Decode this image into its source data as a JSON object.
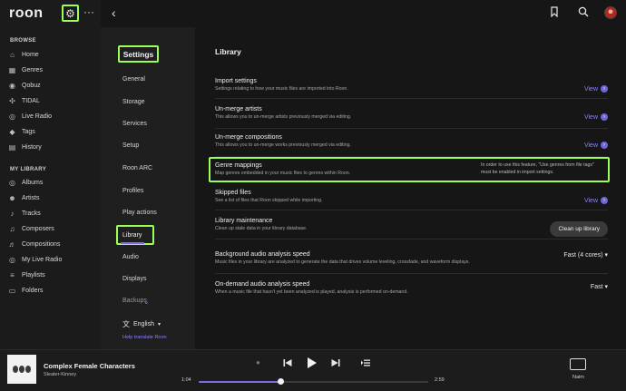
{
  "app": {
    "logo": "roon",
    "more": "···"
  },
  "sidebar": {
    "browse_header": "BROWSE",
    "browse_items": [
      {
        "label": "Home",
        "icon": "⌂"
      },
      {
        "label": "Genres",
        "icon": "▦"
      },
      {
        "label": "Qobuz",
        "icon": "◉"
      },
      {
        "label": "TIDAL",
        "icon": "✣"
      },
      {
        "label": "Live Radio",
        "icon": "◎"
      },
      {
        "label": "Tags",
        "icon": "◆"
      },
      {
        "label": "History",
        "icon": "▤"
      }
    ],
    "library_header": "MY LIBRARY",
    "library_items": [
      {
        "label": "Albums",
        "icon": "◎"
      },
      {
        "label": "Artists",
        "icon": "☻"
      },
      {
        "label": "Tracks",
        "icon": "♪"
      },
      {
        "label": "Composers",
        "icon": "♫"
      },
      {
        "label": "Compositions",
        "icon": "♬"
      },
      {
        "label": "My Live Radio",
        "icon": "◎"
      },
      {
        "label": "Playlists",
        "icon": "≡"
      },
      {
        "label": "Folders",
        "icon": "▭"
      }
    ]
  },
  "settings_nav": {
    "title": "Settings",
    "items": [
      "General",
      "Storage",
      "Services",
      "Setup",
      "Roon ARC",
      "Profiles",
      "Play actions",
      "Library",
      "Audio",
      "Displays",
      "Backups"
    ],
    "active": "Library",
    "language": "English",
    "help_link": "Help translate Roon"
  },
  "main": {
    "title": "Library",
    "rows": [
      {
        "title": "Import settings",
        "desc": "Settings relating to how your music files are imported into Roon.",
        "action": "View"
      },
      {
        "title": "Un-merge artists",
        "desc": "This allows you to un-merge artists previously merged via editing.",
        "action": "View"
      },
      {
        "title": "Un-merge compositions",
        "desc": "This allows you to un-merge works previously merged via editing.",
        "action": "View"
      },
      {
        "title": "Genre mappings",
        "desc": "Map genres embedded in your music files to genres within Roon.",
        "note": "In order to use this feature, \"Use genres from file tags\" must be enabled in import settings."
      },
      {
        "title": "Skipped files",
        "desc": "See a list of files that Roon skipped while importing.",
        "action": "View"
      },
      {
        "title": "Library maintenance",
        "desc": "Clean up stale data in your library database.",
        "button": "Clean up library"
      },
      {
        "title": "Background audio analysis speed",
        "desc": "Music files in your library are analyzed to generate the data that drives volume leveling, crossfade, and waveform displays.",
        "select": "Fast (4 cores) ▾"
      },
      {
        "title": "On-demand audio analysis speed",
        "desc": "When a music file that hasn't yet been analyzed is played, analysis is performed on-demand.",
        "select": "Fast ▾"
      }
    ]
  },
  "player": {
    "track_title": "Complex Female Characters",
    "artist": "Sleater-Kinney",
    "elapsed": "1:04",
    "duration": "2:59",
    "progress": 0.357,
    "zone": "Naim"
  },
  "colors": {
    "accent": "#7b72e0",
    "highlight": "#9cff57",
    "link": "#8a82ff"
  }
}
